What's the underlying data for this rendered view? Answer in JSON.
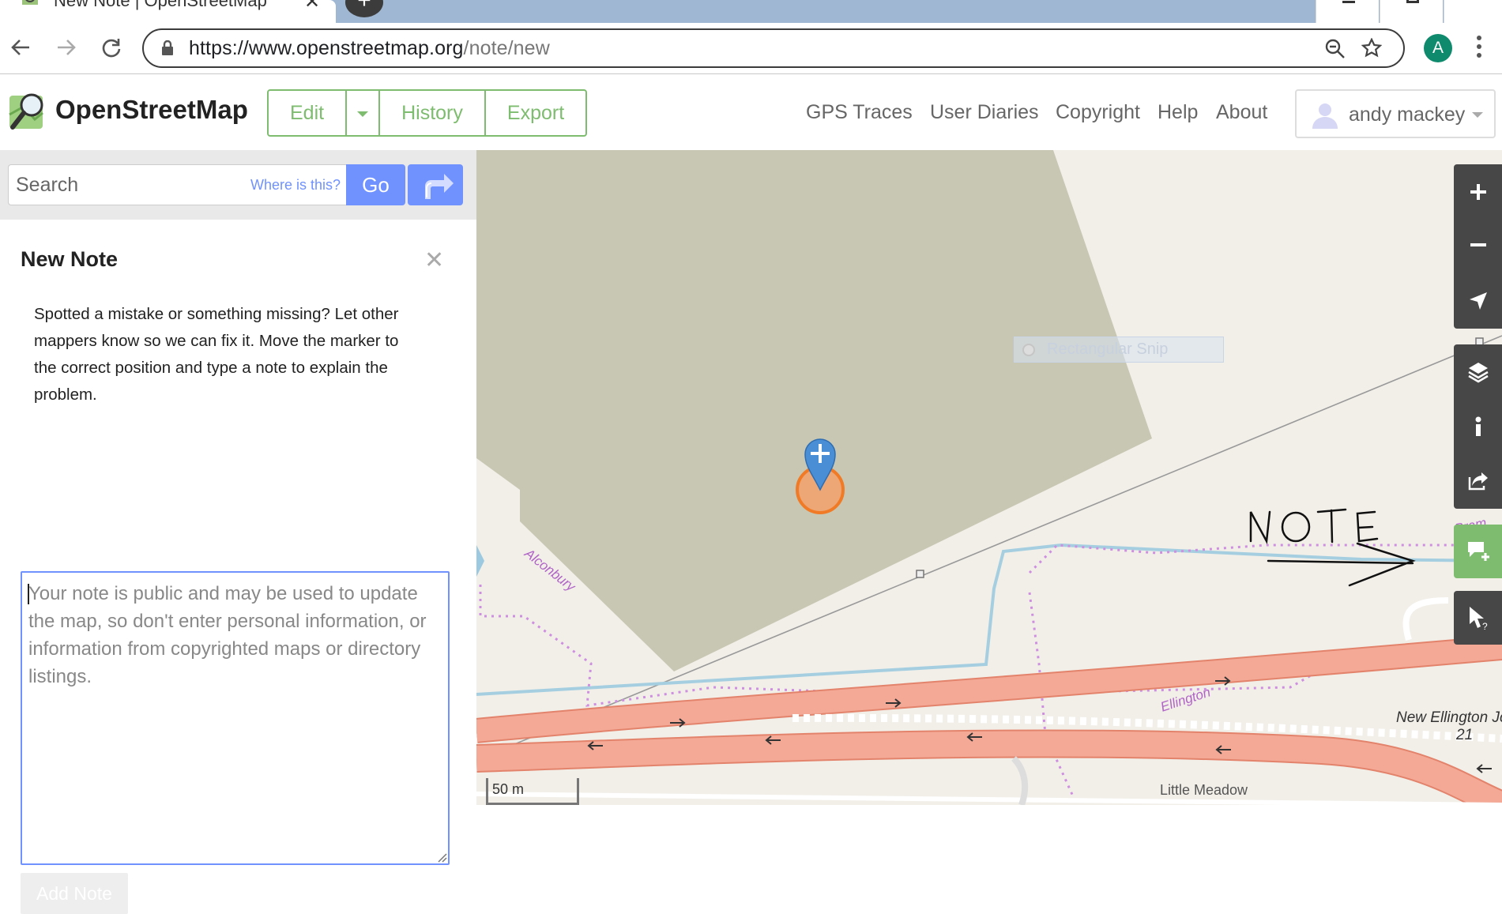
{
  "browser": {
    "tab_title": "New Note | OpenStreetMap",
    "url_host": "https://www.openstreetmap.org",
    "url_path": "/note/new",
    "profile_initial": "A"
  },
  "osm": {
    "brand": "OpenStreetMap",
    "edit_label": "Edit",
    "history_label": "History",
    "export_label": "Export",
    "secondary_nav": [
      "GPS Traces",
      "User Diaries",
      "Copyright",
      "Help",
      "About"
    ],
    "user_name": "andy mackey"
  },
  "search": {
    "placeholder": "Search",
    "where_link": "Where is this?",
    "go_label": "Go"
  },
  "note": {
    "title": "New Note",
    "intro": "Spotted a mistake or something missing? Let other mappers know so we can fix it. Move the marker to the correct position and type a note to explain the problem.",
    "placeholder": "Your note is public and may be used to update the map, so don't enter personal information, or information from copyrighted maps or directory listings.",
    "add_label": "Add Note"
  },
  "map": {
    "labels": {
      "alconbury": "Alconbury",
      "ellington": "Ellington",
      "bram": "Bram",
      "junction_name": "New Ellington Jc",
      "junction_number": "21",
      "little_meadow": "Little Meadow"
    },
    "snip_overlay": "Rectangular Snip",
    "handwritten_annotation": "NOTE",
    "scale": "50 m"
  },
  "colors": {
    "osm_green": "#7ebc6f",
    "link_blue": "#7092ff",
    "motorway": "#f3a996",
    "landuse": "#c8c7b3",
    "marker": "#4a8fd6",
    "note_circle": "#f08a3e",
    "controls": "#474747"
  },
  "icons": [
    "favicon-icon",
    "close-icon",
    "back-icon",
    "forward-icon",
    "reload-icon",
    "lock-icon",
    "zoom-icon",
    "star-icon",
    "kebab-icon",
    "caret-icon",
    "user-avatar-icon",
    "directions-icon",
    "close-x-icon",
    "zoom-in-icon",
    "zoom-out-icon",
    "locate-icon",
    "layers-icon",
    "info-icon",
    "share-icon",
    "add-note-icon",
    "query-icon"
  ]
}
